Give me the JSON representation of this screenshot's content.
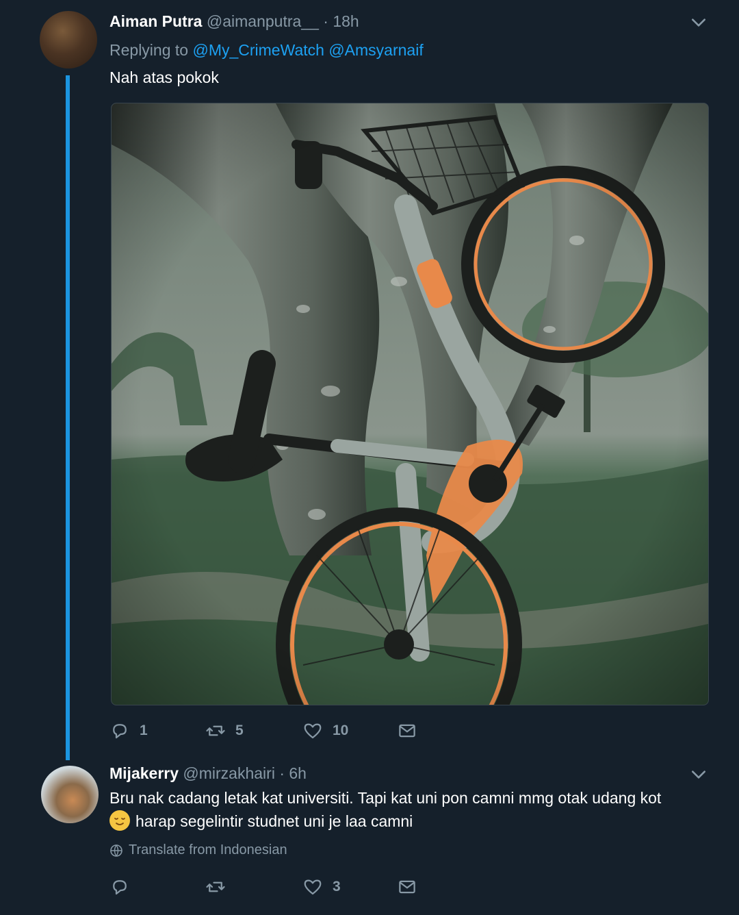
{
  "tweets": [
    {
      "name": "Aiman Putra",
      "handle": "@aimanputra__",
      "separator": "·",
      "time": "18h",
      "replying_prefix": "Replying to",
      "replying_to": [
        "@My_CrimeWatch",
        "@Amsyarnaif"
      ],
      "text": "Nah atas pokok",
      "image_alt": "Orange and grey shared bicycle lodged in the fork of a tree above a grassy park",
      "actions": {
        "replies": "1",
        "retweets": "5",
        "likes": "10"
      }
    },
    {
      "name": "Mijakerry",
      "handle": "@mirzakhairi",
      "separator": "·",
      "time": "6h",
      "text_line1": "Bru nak cadang letak kat universiti. Tapi kat uni pon camni mmg otak udang kot",
      "text_line2": "harap segelintir studnet uni je laa camni",
      "emoji": "relieved-face",
      "translate": "Translate from Indonesian",
      "actions": {
        "replies": "",
        "retweets": "",
        "likes": "3"
      }
    }
  ],
  "colors": {
    "background": "#15202b",
    "text": "#ffffff",
    "secondary": "#8899a6",
    "accent": "#1da1f2",
    "thread": "#1b95e0",
    "bike_orange": "#e8894a"
  },
  "icons": [
    "chevron-down-icon",
    "reply-icon",
    "retweet-icon",
    "like-icon",
    "share-icon",
    "globe-icon"
  ]
}
